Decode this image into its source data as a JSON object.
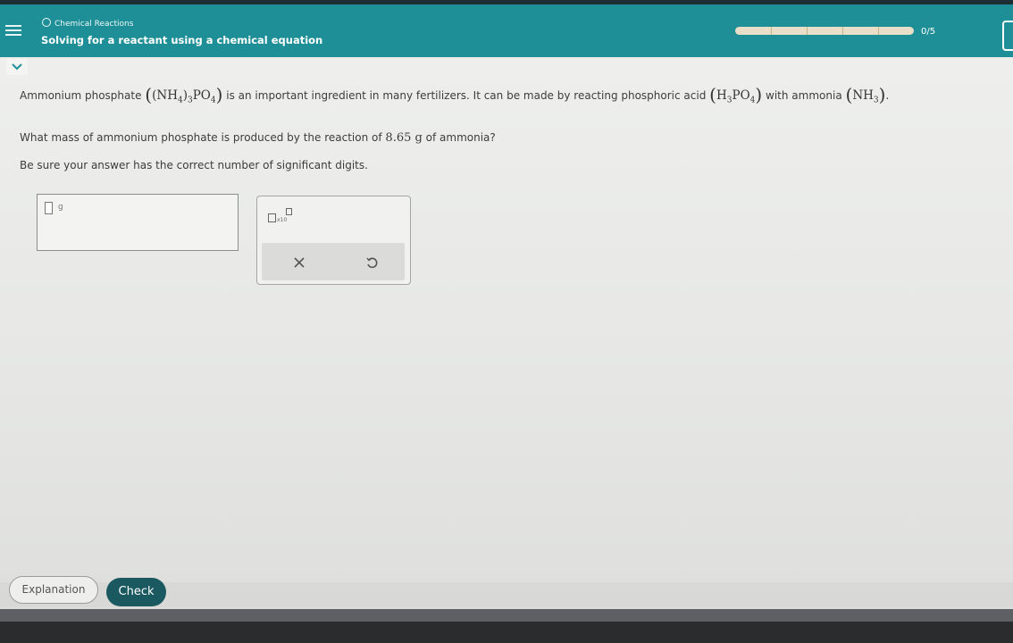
{
  "header": {
    "topic": "Chemical Reactions",
    "lesson_title": "Solving for a reactant using a chemical equation",
    "progress_label": "0/5",
    "progress_fraction": 0.0
  },
  "problem": {
    "intro_1": "Ammonium phosphate",
    "formula_ammonium_phosphate": {
      "a": "(NH",
      "a_sub": "4",
      "b": ")",
      "b_sub": "3",
      "c": "PO",
      "c_sub": "4"
    },
    "intro_2": "is an important ingredient in many fertilizers. It can be made by reacting phosphoric acid",
    "formula_phosphoric_acid": {
      "a": "H",
      "a_sub": "3",
      "b": "PO",
      "b_sub": "4"
    },
    "intro_3": "with ammonia",
    "formula_ammonia": {
      "a": "NH",
      "a_sub": "3"
    },
    "period": ".",
    "question_pre": "What mass of ammonium phosphate is produced by the reaction of",
    "question_value": "8.65 g",
    "question_post": "of ammonia?",
    "hint": "Be sure your answer has the correct number of significant digits."
  },
  "answer": {
    "value": "",
    "unit": "g"
  },
  "tools": {
    "sci_notation_label": "x10",
    "clear_icon": "close-icon",
    "undo_icon": "undo-icon"
  },
  "footer": {
    "explanation_label": "Explanation",
    "check_label": "Check"
  },
  "colors": {
    "header_bg": "#1f8f97",
    "check_bg": "#1b5960"
  }
}
